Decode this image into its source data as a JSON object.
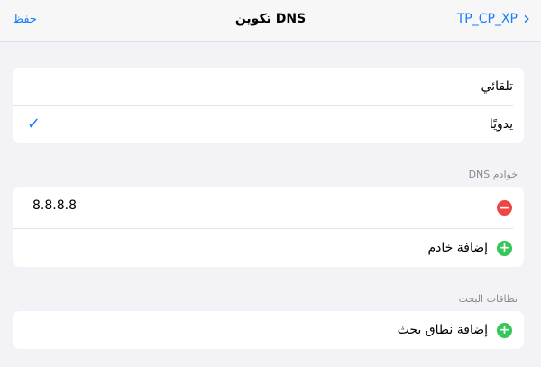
{
  "nav": {
    "back_label": "TP_CP_XP",
    "title": "تكوين DNS",
    "save_label": "حفظ"
  },
  "mode": {
    "auto_label": "تلقائي",
    "manual_label": "يدويًا",
    "selected": "manual"
  },
  "dns_servers": {
    "header": "خوادم DNS",
    "servers": [
      "8.8.8.8"
    ],
    "add_label": "إضافة خادم"
  },
  "search_domains": {
    "header": "نطاقات البحث",
    "add_label": "إضافة نطاق بحث"
  },
  "colors": {
    "accent": "#147efb",
    "remove": "#f04545",
    "add": "#34c759"
  }
}
